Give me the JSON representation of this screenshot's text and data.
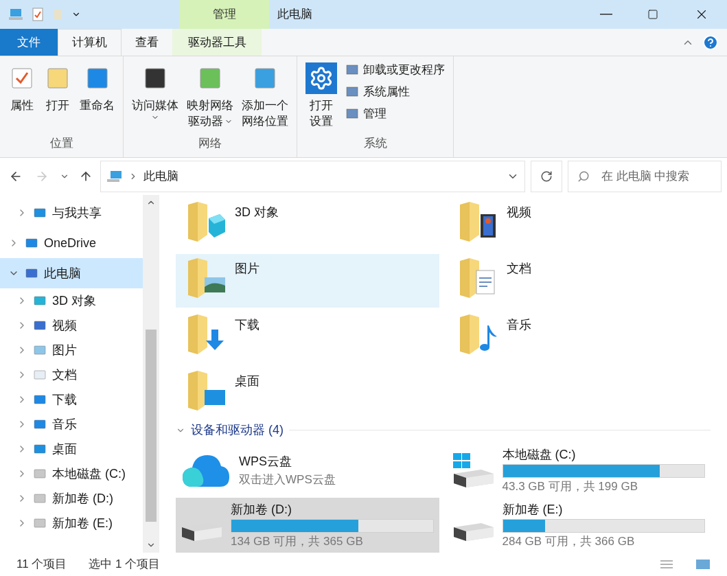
{
  "window": {
    "title": "此电脑",
    "context_tab": "管理"
  },
  "ribbon": {
    "tabs": [
      {
        "label": "文件",
        "kind": "file",
        "selected": false
      },
      {
        "label": "计算机",
        "kind": "tab",
        "selected": true
      },
      {
        "label": "查看",
        "kind": "tab",
        "selected": false
      },
      {
        "label": "驱动器工具",
        "kind": "context",
        "selected": false
      }
    ],
    "groups": [
      {
        "label": "位置",
        "items": [
          {
            "kind": "large",
            "lines": [
              "属性"
            ],
            "dropdown": false
          },
          {
            "kind": "large",
            "lines": [
              "打开"
            ],
            "dropdown": false
          },
          {
            "kind": "large",
            "lines": [
              "重命名"
            ],
            "dropdown": false
          }
        ]
      },
      {
        "label": "网络",
        "items": [
          {
            "kind": "large",
            "lines": [
              "访问媒体"
            ],
            "dropdown": true
          },
          {
            "kind": "large",
            "lines": [
              "映射网络",
              "驱动器"
            ],
            "dropdown": true
          },
          {
            "kind": "large",
            "lines": [
              "添加一个",
              "网络位置"
            ],
            "dropdown": false
          }
        ]
      },
      {
        "label": "系统",
        "items": [
          {
            "kind": "large",
            "lines": [
              "打开",
              "设置"
            ],
            "dropdown": false
          },
          {
            "kind": "small",
            "lines": [
              "卸载或更改程序"
            ]
          },
          {
            "kind": "small",
            "lines": [
              "系统属性"
            ]
          },
          {
            "kind": "small",
            "lines": [
              "管理"
            ]
          }
        ]
      }
    ]
  },
  "address": {
    "path": "此电脑",
    "search_placeholder": "在 此电脑 中搜索"
  },
  "nav": [
    {
      "label": "与我共享",
      "expanded": false,
      "selected": false
    },
    {
      "label": "OneDrive",
      "expanded": false,
      "selected": false
    },
    {
      "label": "此电脑",
      "expanded": true,
      "selected": true,
      "children": [
        {
          "label": "3D 对象",
          "expanded": false,
          "selected": false
        },
        {
          "label": "视频",
          "expanded": false,
          "selected": false
        },
        {
          "label": "图片",
          "expanded": false,
          "selected": false
        },
        {
          "label": "文档",
          "expanded": false,
          "selected": false
        },
        {
          "label": "下载",
          "expanded": false,
          "selected": false
        },
        {
          "label": "音乐",
          "expanded": false,
          "selected": false
        },
        {
          "label": "桌面",
          "expanded": false,
          "selected": false
        },
        {
          "label": "本地磁盘 (C:)",
          "expanded": false,
          "selected": false
        },
        {
          "label": "新加卷 (D:)",
          "expanded": false,
          "selected": false
        },
        {
          "label": "新加卷 (E:)",
          "expanded": false,
          "selected": false
        }
      ]
    }
  ],
  "folders": [
    {
      "label": "3D 对象",
      "selected": false
    },
    {
      "label": "视频",
      "selected": false
    },
    {
      "label": "图片",
      "selected": true
    },
    {
      "label": "文档",
      "selected": false
    },
    {
      "label": "下载",
      "selected": false
    },
    {
      "label": "音乐",
      "selected": false
    },
    {
      "label": "桌面",
      "selected": false
    }
  ],
  "devices": {
    "header": "设备和驱动器 (4)",
    "expanded": true,
    "items": [
      {
        "kind": "cloud",
        "name": "WPS云盘",
        "subtitle": "双击进入WPS云盘",
        "selected": false
      },
      {
        "kind": "system_drive",
        "name": "本地磁盘 (C:)",
        "level": 0.78,
        "reading": "43.3 GB 可用，共 199 GB",
        "selected": false
      },
      {
        "kind": "drive",
        "name": "新加卷 (D:)",
        "level": 0.63,
        "reading": "134 GB 可用，共 365 GB",
        "selected": true
      },
      {
        "kind": "drive",
        "name": "新加卷 (E:)",
        "level": 0.21,
        "reading": "284 GB 可用，共 366 GB",
        "selected": false
      }
    ]
  },
  "status_bar": {
    "count": "11 个项目",
    "selection": "选中 1 个项目"
  }
}
